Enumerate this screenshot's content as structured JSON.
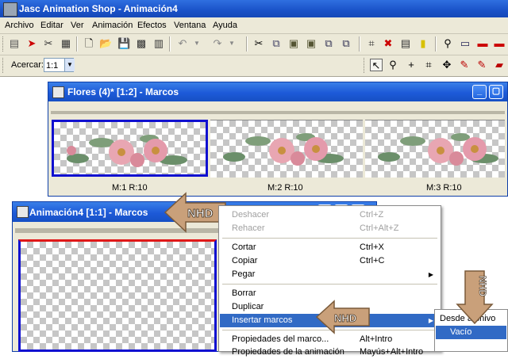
{
  "app": {
    "title": "Jasc Animation Shop - Animación4"
  },
  "menu": [
    "Archivo",
    "Editar",
    "Ver",
    "Animación",
    "Efectos",
    "Ventana",
    "Ayuda"
  ],
  "toolbar2": {
    "zoom_label": "Acercar:",
    "zoom_value": "1:1"
  },
  "window1": {
    "title": "Flores (4)* [1:2] - Marcos",
    "frames": [
      {
        "label": "M:1  R:10"
      },
      {
        "label": "M:2  R:10"
      },
      {
        "label": "M:3  R:10"
      }
    ]
  },
  "window2": {
    "title": "Animación4 [1:1] - Marcos"
  },
  "context_menu": {
    "items": [
      {
        "label": "Deshacer",
        "shortcut": "Ctrl+Z",
        "disabled": true
      },
      {
        "label": "Rehacer",
        "shortcut": "Ctrl+Alt+Z",
        "disabled": true
      },
      {
        "label": "Cortar",
        "shortcut": "Ctrl+X"
      },
      {
        "label": "Copiar",
        "shortcut": "Ctrl+C"
      },
      {
        "label": "Pegar",
        "shortcut": ""
      },
      {
        "label": "Borrar",
        "shortcut": ""
      },
      {
        "label": "Duplicar",
        "shortcut": ""
      },
      {
        "label": "Insertar marcos",
        "shortcut": "",
        "highlighted": true
      },
      {
        "label": "Propiedades del marco...",
        "shortcut": "Alt+Intro"
      },
      {
        "label": "Propiedades de la animación",
        "shortcut": "Mayús+Alt+Intro"
      }
    ]
  },
  "submenu": {
    "items": [
      {
        "label": "Desde archivo"
      },
      {
        "label": "Vacío",
        "highlighted": true
      }
    ]
  },
  "watermark": {
    "text": "NHD"
  },
  "colors": {
    "title_blue": "#1d5ad8",
    "highlight": "#316ac5",
    "selection_border": "#1010d0",
    "watermark_brown": "#c9a07a"
  }
}
